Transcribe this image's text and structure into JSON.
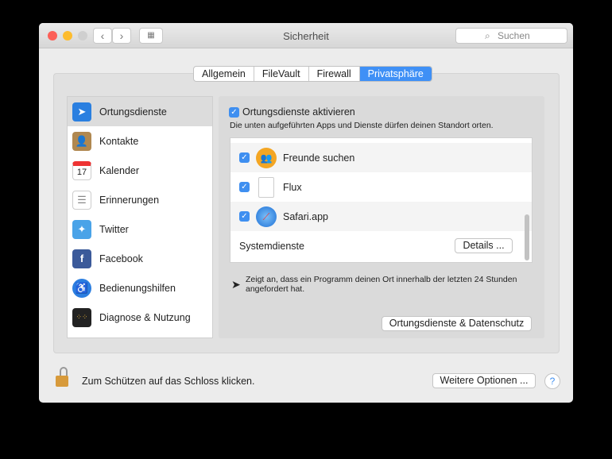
{
  "window": {
    "title": "Sicherheit",
    "search_placeholder": "Suchen"
  },
  "tabs": [
    {
      "label": "Allgemein"
    },
    {
      "label": "FileVault"
    },
    {
      "label": "Firewall"
    },
    {
      "label": "Privatsphäre"
    }
  ],
  "sidebar": {
    "items": [
      {
        "label": "Ortungsdienste"
      },
      {
        "label": "Kontakte"
      },
      {
        "label": "Kalender"
      },
      {
        "label": "Erinnerungen"
      },
      {
        "label": "Twitter"
      },
      {
        "label": "Facebook"
      },
      {
        "label": "Bedienungshilfen"
      },
      {
        "label": "Diagnose & Nutzung"
      }
    ],
    "calendar_day": "17"
  },
  "location": {
    "enable_label": "Ortungsdienste aktivieren",
    "enabled": true,
    "description": "Die unten aufgeführten Apps und Dienste dürfen deinen Standort orten.",
    "apps": [
      {
        "name": "Freunde suchen",
        "checked": true
      },
      {
        "name": "Flux",
        "checked": true
      },
      {
        "name": "Safari.app",
        "checked": true
      }
    ],
    "system_services": "Systemdienste",
    "details_button": "Details ...",
    "note": "Zeigt an, dass ein Programm deinen Ort innerhalb der letzten 24 Stunden angefordert hat.",
    "privacy_button": "Ortungsdienste & Datenschutz"
  },
  "footer": {
    "lock_text": "Zum Schützen auf das Schloss klicken.",
    "more_options": "Weitere Optionen ...",
    "help": "?"
  }
}
